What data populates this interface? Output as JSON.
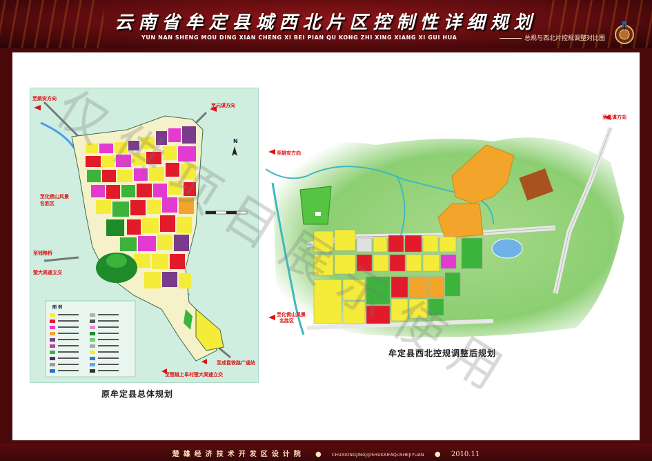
{
  "header": {
    "title": "云南省牟定县城西北片区控制性详细规划",
    "subtitle_pinyin": "YUN NAN SHENG MOU DING XIAN CHENG XI BEI PIAN QU KONG ZHI XING XIANG XI GUI HUA",
    "subtitle_right": "总规与西北片控规调整对比图"
  },
  "left_map": {
    "caption": "原牟定县总体规划",
    "labels": {
      "to_yaoan": "至姚安方向",
      "to_yuanmou": "至元谋方向",
      "to_huafo": "至化佛山风景",
      "to_huafo_2": "名胜区",
      "to_qianqiao": "至钱粮桥",
      "to_chuda": "楚大高速立交",
      "to_chengkun": "至成昆铁路广通站",
      "to_shangfang": "至楚雄上阜村楚大高速立交",
      "north": "N",
      "legend_title": "图  例"
    }
  },
  "right_map": {
    "caption": "牟定县西北控规调整后规划",
    "labels": {
      "to_yuanmou": "至元谋方向",
      "to_yaoan": "至姚安方向",
      "to_huafo": "至化佛山风景",
      "to_huafo_2": "名胜区"
    }
  },
  "watermark": "仅供项目展示使用",
  "footer": {
    "org": "楚雄经济技术开发区设计院",
    "org_pinyin": "CHUXIONGJINGJIJISHUKAIFAQUSHEJIYUAN",
    "date": "2010.11"
  },
  "colors": {
    "header_red": "#8d1518",
    "residential_yellow": "#f5ec3a",
    "commercial_red": "#e21b2a",
    "admin_magenta": "#e33bd0",
    "green_space": "#3cb43c",
    "industrial_purple": "#7a3b8a",
    "education_orange": "#f3a52b"
  }
}
